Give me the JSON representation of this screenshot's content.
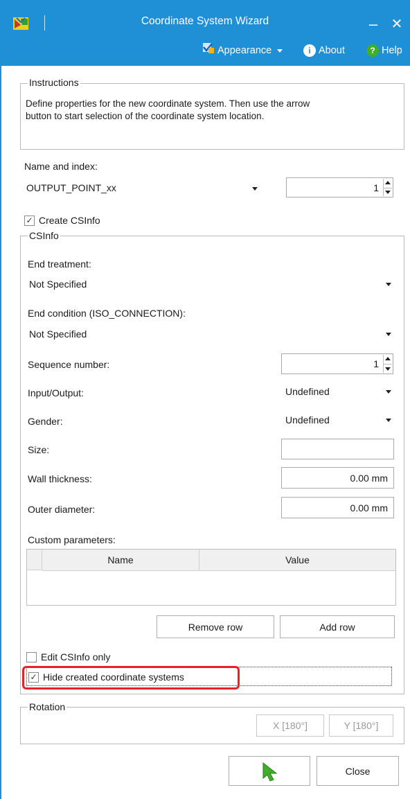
{
  "window": {
    "title": "Coordinate System Wizard",
    "minimize_glyph": "–",
    "close_glyph": "✕",
    "accent": "#1f8fd6"
  },
  "menu": {
    "appearance_label": "Appearance",
    "about_label": "About",
    "help_label": "Help"
  },
  "instructions": {
    "legend": "Instructions",
    "text_line1": "Define properties for the new coordinate system. Then use the arrow",
    "text_line2": "button to start selection of the coordinate system location."
  },
  "name_index": {
    "label": "Name and index:",
    "name_value": "OUTPUT_POINT_xx",
    "index_value": "1"
  },
  "create_csinfo": {
    "label": "Create CSInfo",
    "checked": true,
    "check_glyph": "✓"
  },
  "csinfo": {
    "legend": "CSInfo",
    "end_treatment_label": "End treatment:",
    "end_treatment_value": "Not Specified",
    "end_condition_label": "End condition (ISO_CONNECTION):",
    "end_condition_value": "Not Specified",
    "sequence_label": "Sequence number:",
    "sequence_value": "1",
    "io_label": "Input/Output:",
    "io_value": "Undefined",
    "gender_label": "Gender:",
    "gender_value": "Undefined",
    "size_label": "Size:",
    "size_value": "",
    "wall_label": "Wall thickness:",
    "wall_value": "0.00 mm",
    "outer_label": "Outer diameter:",
    "outer_value": "0.00 mm",
    "custom_label": "Custom parameters:",
    "col_name": "Name",
    "col_value": "Value",
    "remove_row": "Remove row",
    "add_row": "Add row",
    "edit_only_label": "Edit CSInfo only",
    "edit_only_checked": false,
    "hide_label": "Hide created coordinate systems",
    "hide_checked": true,
    "check_glyph": "✓",
    "highlight_color": "#e8202a"
  },
  "rotation": {
    "legend": "Rotation",
    "x_btn": "X [180°]",
    "y_btn": "Y [180°]"
  },
  "footer": {
    "close_label": "Close",
    "arrow_color": "#3fae29"
  }
}
